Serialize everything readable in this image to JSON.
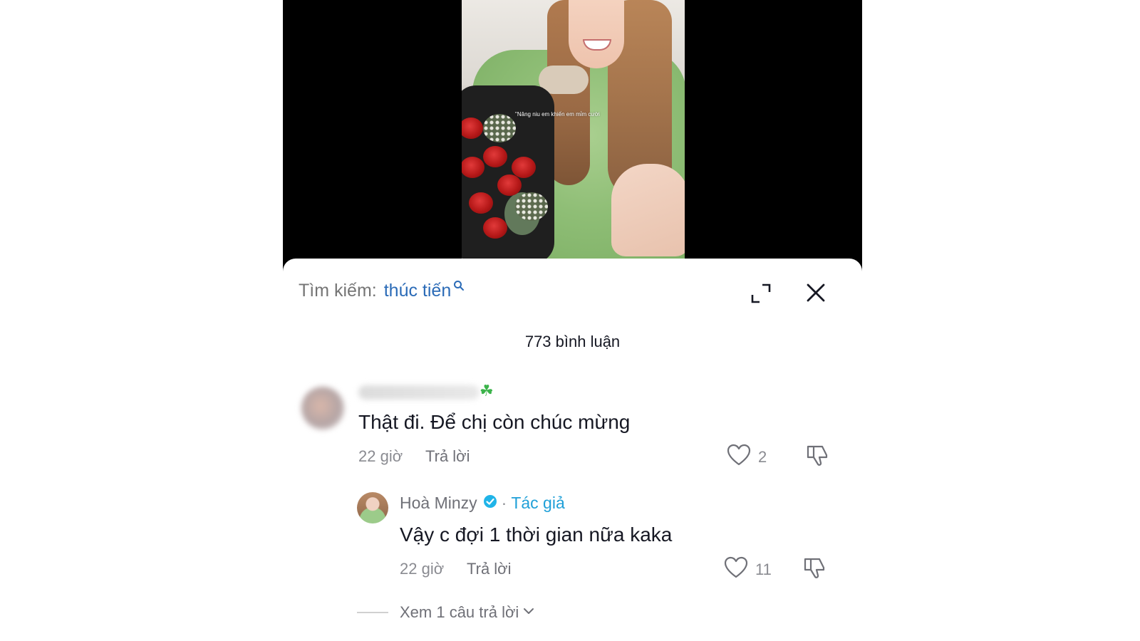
{
  "video": {
    "caption": "\"Nâng niu em khiến em mỉm cười"
  },
  "header": {
    "search_prefix": "Tìm kiếm:",
    "search_term": "thúc tiến",
    "icons": [
      "search-icon",
      "expand-icon",
      "close-icon"
    ]
  },
  "comments_count": "773 bình luận",
  "comments": [
    {
      "text": "Thật đi. Để chị còn chúc mừng",
      "time": "22 giờ",
      "reply_label": "Trả lời",
      "likes": "2"
    }
  ],
  "reply": {
    "author": "Hoà Minzy",
    "separator": "·",
    "author_tag": "Tác giả",
    "text": "Vậy c đợi 1 thời gian nữa kaka",
    "time": "22 giờ",
    "reply_label": "Trả lời",
    "likes": "11"
  },
  "view_more": "Xem 1 câu trả lời",
  "colors": {
    "accent_blue": "#2b6bb7",
    "author_tag": "#20a0d8",
    "verified": "#20b4e8",
    "text": "#161823",
    "muted": "#8a8b91"
  }
}
